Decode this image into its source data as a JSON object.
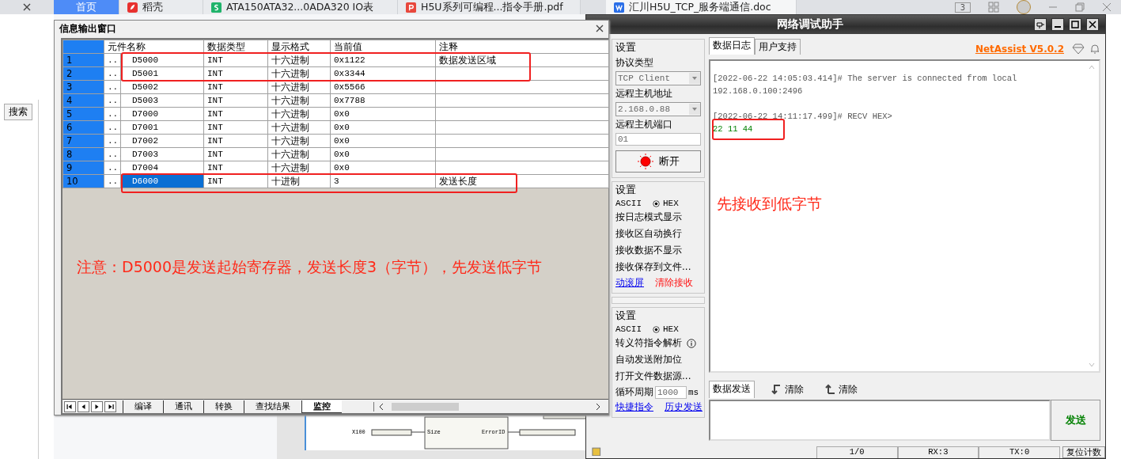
{
  "browser_tabs": [
    {
      "label": "首页",
      "kind": "home",
      "selected": true
    },
    {
      "label": "稻壳",
      "kind": "leaf",
      "selected": false
    },
    {
      "label": "ATA150ATA32...0ADA320 IO表",
      "kind": "sheet",
      "selected": false
    },
    {
      "label": "H5U系列可编程...指令手册.pdf",
      "kind": "pdf",
      "selected": false
    },
    {
      "label": "汇川H5U_TCP_服务端通信.doc",
      "kind": "doc",
      "selected": false
    }
  ],
  "browser_badge": "3",
  "left_pane": {
    "search_button": "搜索"
  },
  "info_window": {
    "title": "信息输出窗口",
    "columns": [
      "元件名称",
      "数据类型",
      "显示格式",
      "当前值",
      "注释"
    ],
    "rows": [
      {
        "index": "1",
        "dots": "...",
        "name": "D5000",
        "type": "INT",
        "format": "十六进制",
        "value": "0x1122",
        "comment": "数据发送区域",
        "selected": false
      },
      {
        "index": "2",
        "dots": "...",
        "name": "D5001",
        "type": "INT",
        "format": "十六进制",
        "value": "0x3344",
        "selected": false
      },
      {
        "index": "3",
        "dots": "...",
        "name": "D5002",
        "type": "INT",
        "format": "十六进制",
        "value": "0x5566",
        "selected": false
      },
      {
        "index": "4",
        "dots": "...",
        "name": "D5003",
        "type": "INT",
        "format": "十六进制",
        "value": "0x7788",
        "selected": false
      },
      {
        "index": "5",
        "dots": "...",
        "name": "D7000",
        "type": "INT",
        "format": "十六进制",
        "value": "0x0",
        "selected": false
      },
      {
        "index": "6",
        "dots": "...",
        "name": "D7001",
        "type": "INT",
        "format": "十六进制",
        "value": "0x0",
        "selected": false
      },
      {
        "index": "7",
        "dots": "...",
        "name": "D7002",
        "type": "INT",
        "format": "十六进制",
        "value": "0x0",
        "selected": false
      },
      {
        "index": "8",
        "dots": "...",
        "name": "D7003",
        "type": "INT",
        "format": "十六进制",
        "value": "0x0",
        "selected": false
      },
      {
        "index": "9",
        "dots": "...",
        "name": "D7004",
        "type": "INT",
        "format": "十六进制",
        "value": "0x0",
        "selected": false
      },
      {
        "index": "10",
        "dots": "...",
        "name": "D6000",
        "type": "INT",
        "format": "十进制",
        "value": "3",
        "comment": "发送长度",
        "selected": true
      }
    ],
    "note": "注意：D5000是发送起始寄存器，发送长度3（字节），先发送低字节",
    "tabs": [
      {
        "label": "编译",
        "selected": false
      },
      {
        "label": "通讯",
        "selected": false
      },
      {
        "label": "转换",
        "selected": false
      },
      {
        "label": "查找结果",
        "selected": false
      },
      {
        "label": "监控",
        "selected": true
      }
    ]
  },
  "diagram": {
    "input_label": "X100",
    "pin_in": "Size",
    "pin_out": "ErrorID"
  },
  "netassist": {
    "title": "网络调试助手",
    "version": "NetAssist V5.0.2",
    "network_settings": {
      "title": "设置",
      "protocol_label": "协议类型",
      "protocol": "TCP Client",
      "host_label": "远程主机地址",
      "host": "2.168.0.88",
      "port_label": "远程主机端口",
      "port": "01",
      "connect_button": "断开"
    },
    "receive_settings": {
      "title": "设置",
      "ascii": "ASCII",
      "hex": {
        "label": "HEX",
        "selected": true
      },
      "options": [
        {
          "label": "按日志模式显示",
          "hint": false
        },
        {
          "label": "接收区自动换行",
          "hint": false
        },
        {
          "label": "接收数据不显示",
          "hint": false
        },
        {
          "label": "接收保存到文件...",
          "hint": false
        }
      ],
      "links": [
        {
          "label": "动滚屏",
          "kind": "link"
        },
        {
          "label": "清除接收",
          "kind": "danger"
        }
      ]
    },
    "send_settings": {
      "title": "设置",
      "ascii": "ASCII",
      "hex": {
        "label": "HEX",
        "selected": true
      },
      "options": [
        {
          "label": "转义符指令解析",
          "hint": true
        },
        {
          "label": "自动发送附加位",
          "hint": false
        },
        {
          "label": "打开文件数据源...",
          "hint": false
        }
      ],
      "interval_label": "循环周期",
      "interval": "1000",
      "interval_unit": "ms",
      "links": [
        {
          "label": "快捷指令",
          "kind": "link"
        },
        {
          "label": "历史发送",
          "kind": "link"
        }
      ]
    },
    "log_tabs": [
      {
        "label": "数据日志",
        "selected": true
      },
      {
        "label": "用户支持",
        "selected": false
      }
    ],
    "log": [
      {
        "kind": "header",
        "text": "[2022-06-22 14:05:03.414]# The server is connected from local"
      },
      {
        "kind": "info",
        "text": "192.168.0.100:2496"
      },
      {
        "kind": "header",
        "text": "[2022-06-22 14:11:17.499]# RECV HEX>"
      },
      {
        "kind": "data",
        "text": "22 11 44"
      }
    ],
    "annotation": "先接收到低字节",
    "send_tab": "数据发送",
    "clear_buttons": [
      {
        "label": "清除",
        "kind": "down"
      },
      {
        "label": "清除",
        "kind": "up"
      }
    ],
    "send_button": "发送",
    "status": [
      "1/0",
      "RX:3",
      "TX:0"
    ],
    "reset_button": "复位计数"
  }
}
